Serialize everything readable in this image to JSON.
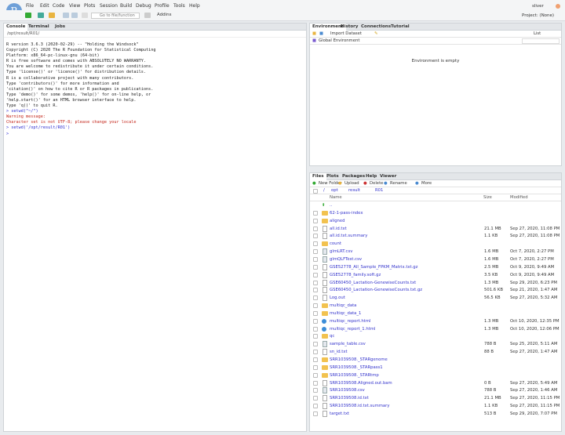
{
  "menu": [
    "File",
    "Edit",
    "Code",
    "View",
    "Plots",
    "Session",
    "Build",
    "Debug",
    "Profile",
    "Tools",
    "Help"
  ],
  "logo": "R",
  "toolbar": {
    "goto_placeholder": "Go to file/function",
    "addins": "Addins"
  },
  "user": "sliver",
  "project": "Project: (None)",
  "console": {
    "tabs": [
      "Console",
      "Terminal",
      "Jobs"
    ],
    "path": "/opt/result/R01/",
    "lines": [
      {
        "t": "R version 3.6.3 (2020-02-29) -- \"Holding the Windsock\"",
        "c": ""
      },
      {
        "t": "Copyright (C) 2020 The R Foundation for Statistical Computing",
        "c": ""
      },
      {
        "t": "Platform: x86_64-pc-linux-gnu (64-bit)",
        "c": ""
      },
      {
        "t": "",
        "c": ""
      },
      {
        "t": "R is free software and comes with ABSOLUTELY NO WARRANTY.",
        "c": ""
      },
      {
        "t": "You are welcome to redistribute it under certain conditions.",
        "c": ""
      },
      {
        "t": "Type 'license()' or 'licence()' for distribution details.",
        "c": ""
      },
      {
        "t": "",
        "c": ""
      },
      {
        "t": "R is a collaborative project with many contributors.",
        "c": ""
      },
      {
        "t": "Type 'contributors()' for more information and",
        "c": ""
      },
      {
        "t": "'citation()' on how to cite R or R packages in publications.",
        "c": ""
      },
      {
        "t": "",
        "c": ""
      },
      {
        "t": "Type 'demo()' for some demos, 'help()' for on-line help, or",
        "c": ""
      },
      {
        "t": "'help.start()' for an HTML browser interface to help.",
        "c": ""
      },
      {
        "t": "Type 'q()' to quit R.",
        "c": ""
      },
      {
        "t": "",
        "c": ""
      },
      {
        "t": "> setwd(\"~/\")",
        "c": "blue"
      },
      {
        "t": "Warning message:",
        "c": "red"
      },
      {
        "t": "Character set is not UTF-8; please change your locale",
        "c": "red"
      },
      {
        "t": "> setwd('/opt/result/R01')",
        "c": "blue"
      },
      {
        "t": "> ",
        "c": "blue"
      }
    ]
  },
  "environment": {
    "tabs": [
      "Environment",
      "History",
      "Connections",
      "Tutorial"
    ],
    "import_dataset": "Import Dataset",
    "list_label": "List",
    "scope": "Global Environment",
    "empty_message": "Environment is empty"
  },
  "files": {
    "tabs": [
      "Files",
      "Plots",
      "Packages",
      "Help",
      "Viewer"
    ],
    "actions": [
      "New Folder",
      "Upload",
      "Delete",
      "Rename",
      "More"
    ],
    "breadcrumb": [
      "/",
      "opt",
      "result",
      "R01"
    ],
    "columns": [
      "Name",
      "Size",
      "Modified"
    ],
    "up": "..",
    "rows": [
      {
        "name": "62-1-pass-index",
        "type": "folder",
        "size": "",
        "modified": ""
      },
      {
        "name": "aligned",
        "type": "folder",
        "size": "",
        "modified": ""
      },
      {
        "name": "all.id.txt",
        "type": "file",
        "size": "21.1 MB",
        "modified": "Sep 27, 2020, 11:08 PM"
      },
      {
        "name": "all.id.txt.summary",
        "type": "file",
        "size": "1.1 KB",
        "modified": "Sep 27, 2020, 11:08 PM"
      },
      {
        "name": "count",
        "type": "folder",
        "size": "",
        "modified": ""
      },
      {
        "name": "glmLRT.csv",
        "type": "csv",
        "size": "1.6 MB",
        "modified": "Oct 7, 2020, 2:27 PM"
      },
      {
        "name": "glmQLFTest.csv",
        "type": "csv",
        "size": "1.6 MB",
        "modified": "Oct 7, 2020, 2:27 PM"
      },
      {
        "name": "GSE52778_All_Sample_FPKM_Matrix.txt.gz",
        "type": "file",
        "size": "2.5 MB",
        "modified": "Oct 9, 2020, 9:49 AM"
      },
      {
        "name": "GSE52778_family.soft.gz",
        "type": "file",
        "size": "3.5 KB",
        "modified": "Oct 9, 2020, 9:49 AM"
      },
      {
        "name": "GSE60450_Lactation-GenewiseCounts.txt",
        "type": "file",
        "size": "1.3 MB",
        "modified": "Sep 29, 2020, 6:23 PM"
      },
      {
        "name": "GSE60450_Lactation-GenewiseCounts.txt.gz",
        "type": "file",
        "size": "501.6 KB",
        "modified": "Sep 21, 2020, 1:47 AM"
      },
      {
        "name": "Log.out",
        "type": "file",
        "size": "56.5 KB",
        "modified": "Sep 27, 2020, 5:32 AM"
      },
      {
        "name": "multiqc_data",
        "type": "folder",
        "size": "",
        "modified": ""
      },
      {
        "name": "multiqc_data_1",
        "type": "folder",
        "size": "",
        "modified": ""
      },
      {
        "name": "multiqc_report.html",
        "type": "html",
        "size": "1.3 MB",
        "modified": "Oct 10, 2020, 12:35 PM"
      },
      {
        "name": "multiqc_report_1.html",
        "type": "html",
        "size": "1.3 MB",
        "modified": "Oct 10, 2020, 12:06 PM"
      },
      {
        "name": "qc",
        "type": "folder",
        "size": "",
        "modified": ""
      },
      {
        "name": "sample_table.csv",
        "type": "csv",
        "size": "788 B",
        "modified": "Sep 25, 2020, 5:11 AM"
      },
      {
        "name": "sn_id.txt",
        "type": "file",
        "size": "88 B",
        "modified": "Sep 27, 2020, 1:47 AM"
      },
      {
        "name": "SRR1039508._STARgenome",
        "type": "folder",
        "size": "",
        "modified": ""
      },
      {
        "name": "SRR1039508._STARpass1",
        "type": "folder",
        "size": "",
        "modified": ""
      },
      {
        "name": "SRR1039508._STARtmp",
        "type": "folder",
        "size": "",
        "modified": ""
      },
      {
        "name": "SRR1039508.Aligned.out.bam",
        "type": "file",
        "size": "0 B",
        "modified": "Sep 27, 2020, 5:49 AM"
      },
      {
        "name": "SRR1039508.csv",
        "type": "csv",
        "size": "788 B",
        "modified": "Sep 27, 2020, 1:46 AM"
      },
      {
        "name": "SRR1039508.id.txt",
        "type": "file",
        "size": "21.1 MB",
        "modified": "Sep 27, 2020, 11:15 PM"
      },
      {
        "name": "SRR1039508.id.txt.summary",
        "type": "file",
        "size": "1.1 KB",
        "modified": "Sep 27, 2020, 11:15 PM"
      },
      {
        "name": "target.txt",
        "type": "file",
        "size": "513 B",
        "modified": "Sep 29, 2020, 7:07 PM"
      }
    ]
  }
}
